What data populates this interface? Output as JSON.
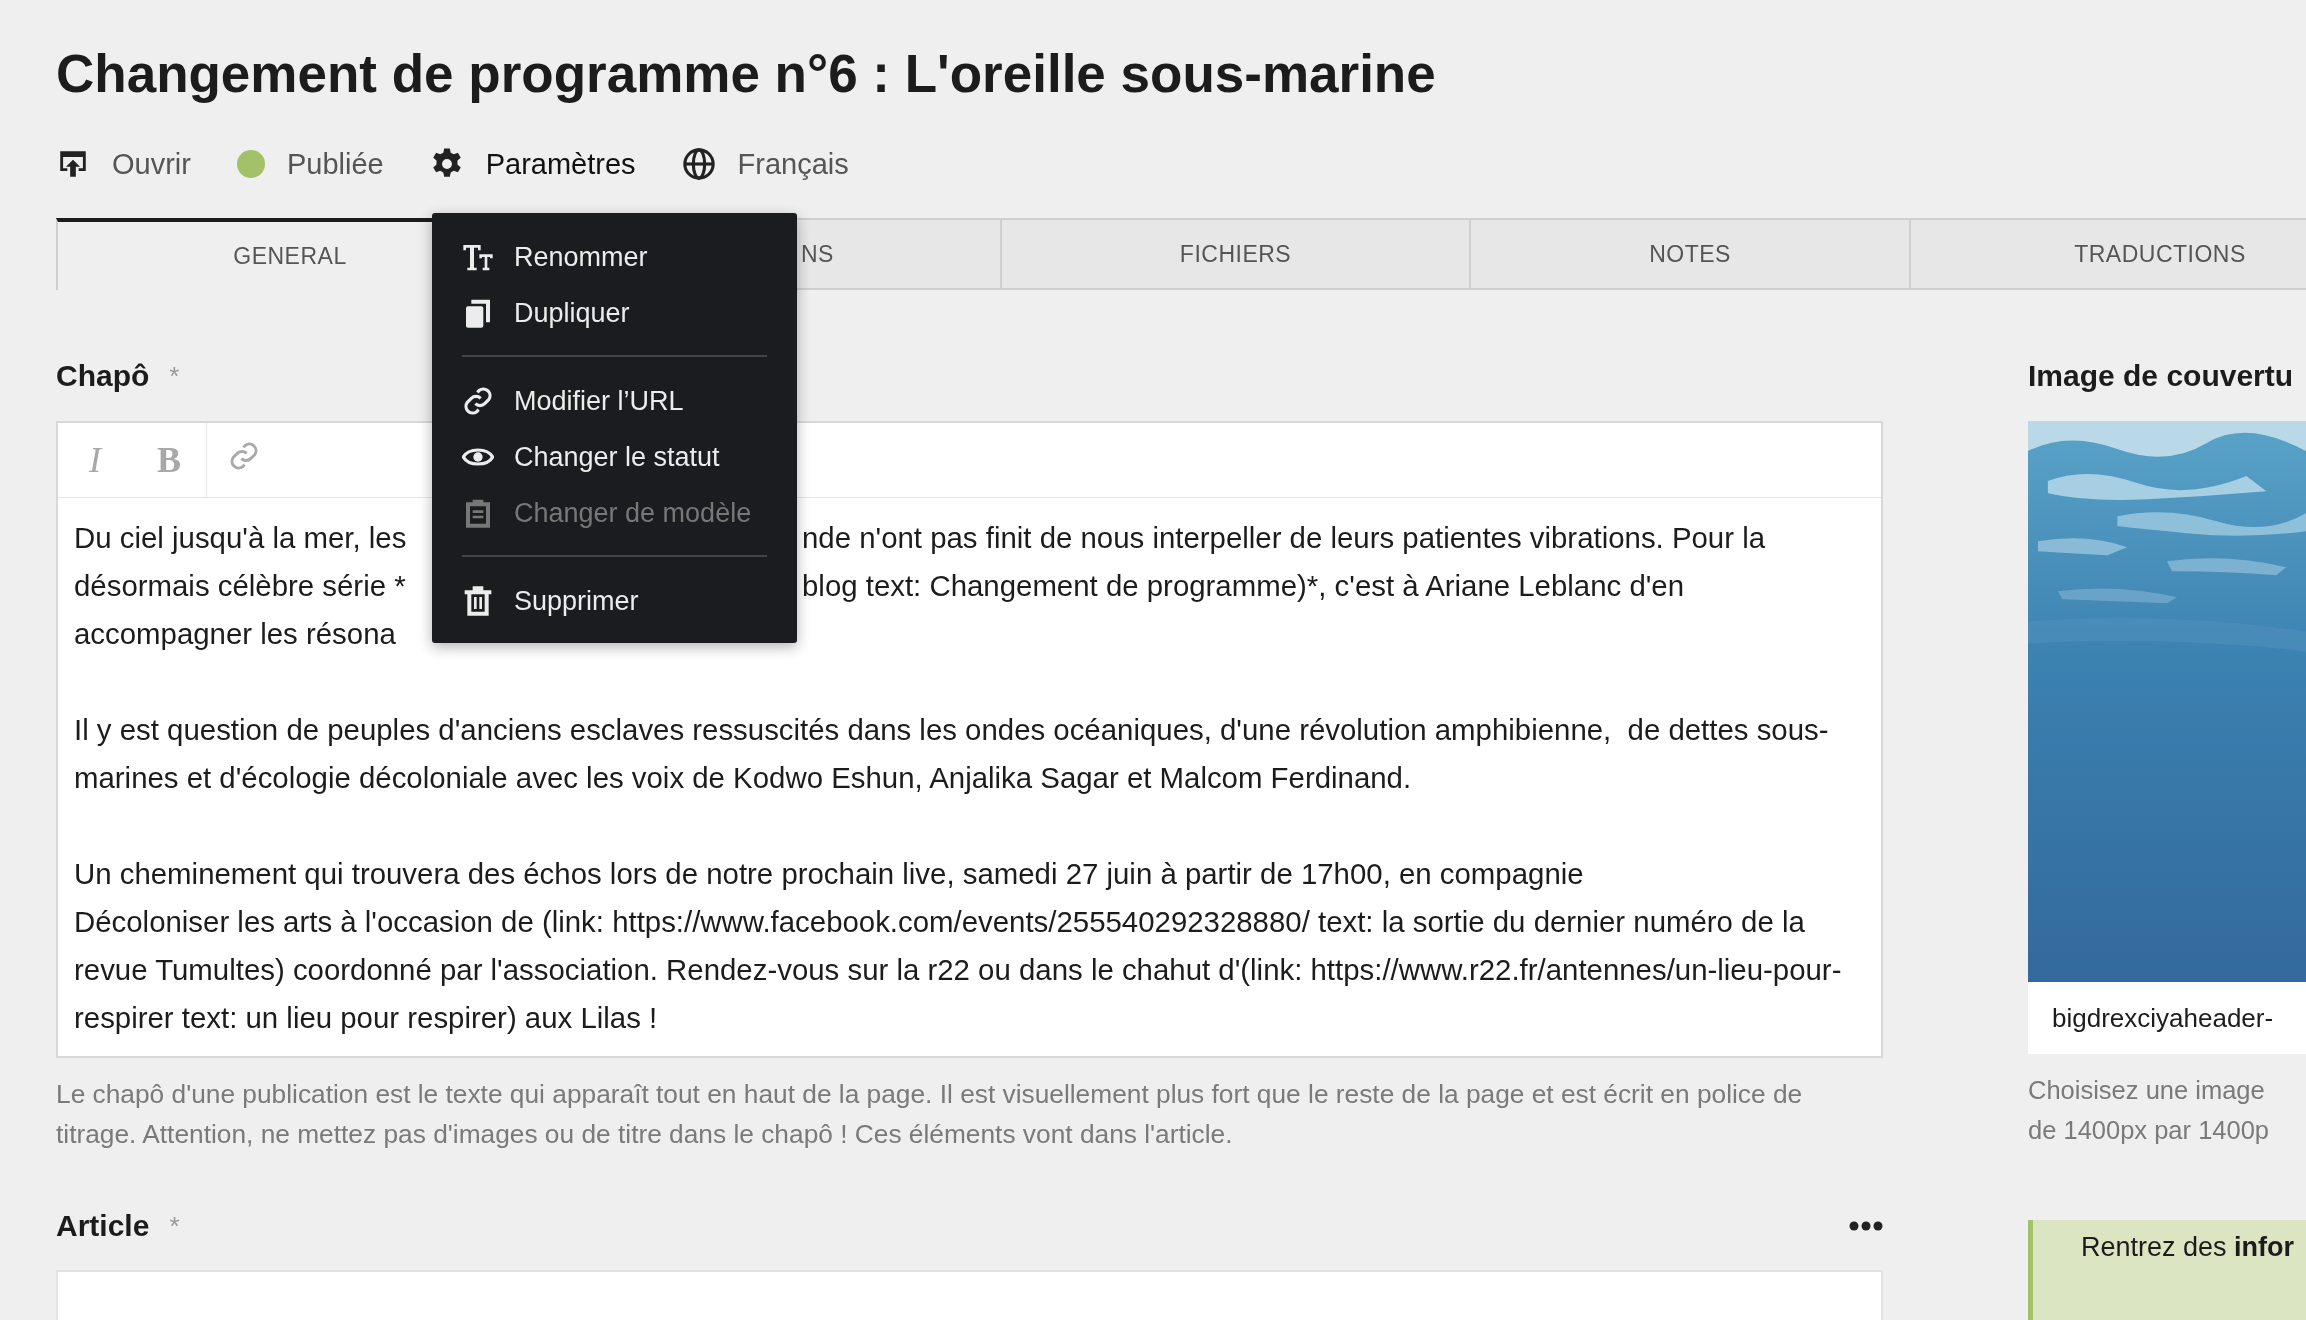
{
  "title": "Changement de programme n°6 : L'oreille sous-marine",
  "toolbar": [
    {
      "kind": "open",
      "label": "Ouvrir",
      "expanded": false
    },
    {
      "kind": "status",
      "label": "Publiée",
      "color": "#a3c168",
      "expanded": false
    },
    {
      "kind": "settings",
      "label": "Paramètres",
      "expanded": true
    },
    {
      "kind": "language",
      "label": "Français",
      "expanded": false
    }
  ],
  "tabs": [
    {
      "label": "GENERAL",
      "selected": true
    },
    {
      "label": "NS",
      "selected": false
    },
    {
      "label": "FICHIERS",
      "selected": false
    },
    {
      "label": "NOTES",
      "selected": false
    },
    {
      "label": "TRADUCTIONS",
      "selected": false
    }
  ],
  "menu": {
    "groups": [
      [
        {
          "kind": "rename",
          "label": "Renommer",
          "disabled": false
        },
        {
          "kind": "duplicate",
          "label": "Dupliquer",
          "disabled": false
        }
      ],
      [
        {
          "kind": "url",
          "label": "Modifier l’URL",
          "disabled": false
        },
        {
          "kind": "status",
          "label": "Changer le statut",
          "disabled": false
        },
        {
          "kind": "template",
          "label": "Changer de modèle",
          "disabled": true
        }
      ],
      [
        {
          "kind": "delete",
          "label": "Supprimer",
          "disabled": false
        }
      ]
    ]
  },
  "chapo": {
    "label": "Chapô",
    "required_mark": "*",
    "editor_tools": [
      {
        "kind": "italic",
        "label": "I"
      },
      {
        "kind": "bold",
        "label": "B"
      },
      {
        "kind": "link"
      }
    ],
    "covered_lines": [
      [
        "Du ciel jusqu'à la mer, les",
        "nde n'ont pas finit de nous interpeller de leurs patientes vibrations. Pour la"
      ],
      [
        "désormais célèbre série *",
        "blog text: Changement de programme)*, c'est à Ariane Leblanc d'en"
      ],
      [
        "accompagner les résona"
      ]
    ],
    "paragraphs": [
      "Il y est question de peuples d'anciens esclaves ressuscités dans les ondes océaniques, d'une révolution amphibienne,  de dettes sous-marines et d'écologie décoloniale avec les voix de Kodwo Eshun, Anjalika Sagar et Malcom Ferdinand.",
      "Un cheminement qui trouvera des échos lors de notre prochain live, samedi 27 juin à partir de 17h00, en compagnie\nDécoloniser les arts à l'occasion de (link: https://www.facebook.com/events/255540292328880/ text: la sortie du dernier numéro de la revue Tumultes) coordonné par l'association. Rendez-vous sur la r22 ou dans le chahut d'(link: https://www.r22.fr/antennes/un-lieu-pour-respirer text: un lieu pour respirer) aux Lilas !"
    ],
    "help": "Le chapô d'une publication est le texte qui apparaît tout en haut de la page. Il est visuellement plus fort que le reste de la page et est écrit en police de titrage. Attention, ne mettez pas d'images ou de titre dans le chapô ! Ces éléments vont dans l'article."
  },
  "article": {
    "label": "Article",
    "required_mark": "*"
  },
  "cover": {
    "label": "Image de couvertu",
    "image": {
      "kind": "picture"
    },
    "filename": "bigdrexciyaheader-",
    "help_lines": [
      "Choisisez une image",
      "de 1400px par 1400p"
    ],
    "notice": "Rentrez des **infor**"
  }
}
